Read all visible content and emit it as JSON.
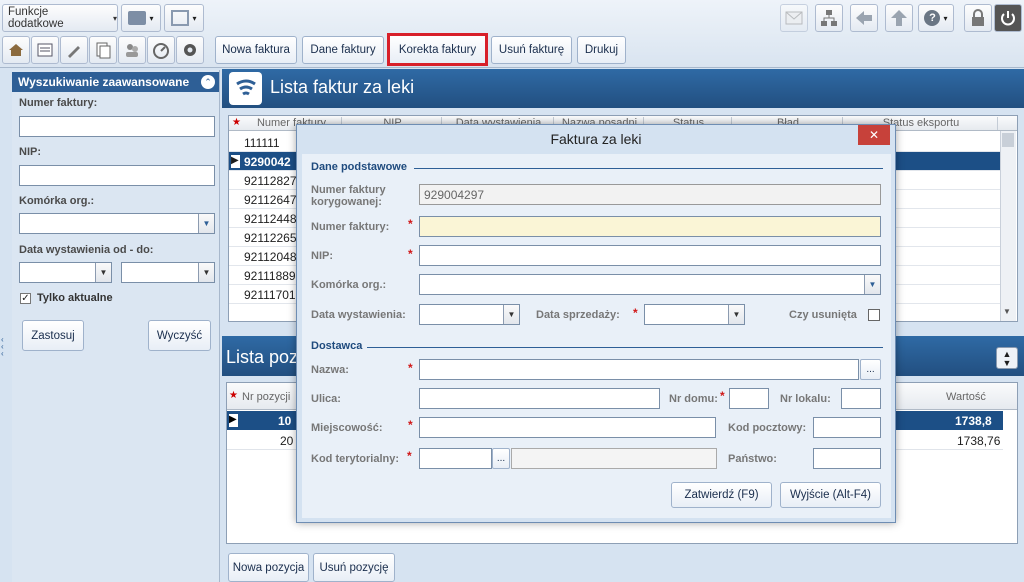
{
  "toolbar": {
    "funkcje_label": "Funkcje dodatkowe",
    "buttons": [
      "Nowa faktura",
      "Dane faktury",
      "Korekta faktury",
      "Usuń fakturę",
      "Drukuj"
    ]
  },
  "sidebar": {
    "title": "Wyszukiwanie zaawansowane",
    "numer_label": "Numer faktury:",
    "nip_label": "NIP:",
    "komorka_label": "Komórka org.:",
    "data_label": "Data wystawienia od - do:",
    "tylko_label": "Tylko aktualne",
    "tylko_checked": true,
    "zastosuj": "Zastosuj",
    "wyczysc": "Wyczyść"
  },
  "list": {
    "title": "Lista faktur za leki",
    "columns": [
      "Numer faktury",
      "NIP",
      "Data wystawienia",
      "Nazwa posadni",
      "Status",
      "Błąd",
      "Status eksportu"
    ],
    "rows": [
      "111111",
      "9290042",
      "92112827",
      "92112647",
      "92112448",
      "92112265",
      "92112048",
      "92111889",
      "92111701"
    ],
    "selected_index": 1
  },
  "positions": {
    "title": "Lista pozycji",
    "col_nr": "Nr pozycji",
    "col_wartosc": "Wartość",
    "rows": [
      {
        "nr": "10",
        "wartosc": "1738,8"
      },
      {
        "nr": "20",
        "wartosc": "1738,76"
      }
    ],
    "nowa": "Nowa pozycja",
    "usun": "Usuń pozycję"
  },
  "dialog": {
    "title": "Faktura za leki",
    "close": "✕",
    "section1": "Dane podstawowe",
    "numer_kor_label": "Numer faktury korygowanej:",
    "numer_kor_value": "929004297",
    "numer_label": "Numer faktury:",
    "nip_label": "NIP:",
    "komorka_label": "Komórka org.:",
    "data_wyst_label": "Data wystawienia:",
    "data_sprz_label": "Data sprzedaży:",
    "czy_usunieta_label": "Czy usunięta",
    "section2": "Dostawca",
    "nazwa_label": "Nazwa:",
    "ulica_label": "Ulica:",
    "nr_domu_label": "Nr domu:",
    "nr_lokalu_label": "Nr lokalu:",
    "miejscowosc_label": "Miejscowość:",
    "kod_pocztowy_label": "Kod pocztowy:",
    "kod_teryt_label": "Kod terytorialny:",
    "panstwo_label": "Państwo:",
    "ellipsis": "...",
    "zatwierdz": "Zatwierdź (F9)",
    "wyjscie": "Wyjście (Alt-F4)"
  },
  "colors": {
    "header_blue": "#2e5f96",
    "selected_row": "#1c4f86",
    "highlight_red": "#d8202a",
    "required_fill": "#faf5d6"
  }
}
